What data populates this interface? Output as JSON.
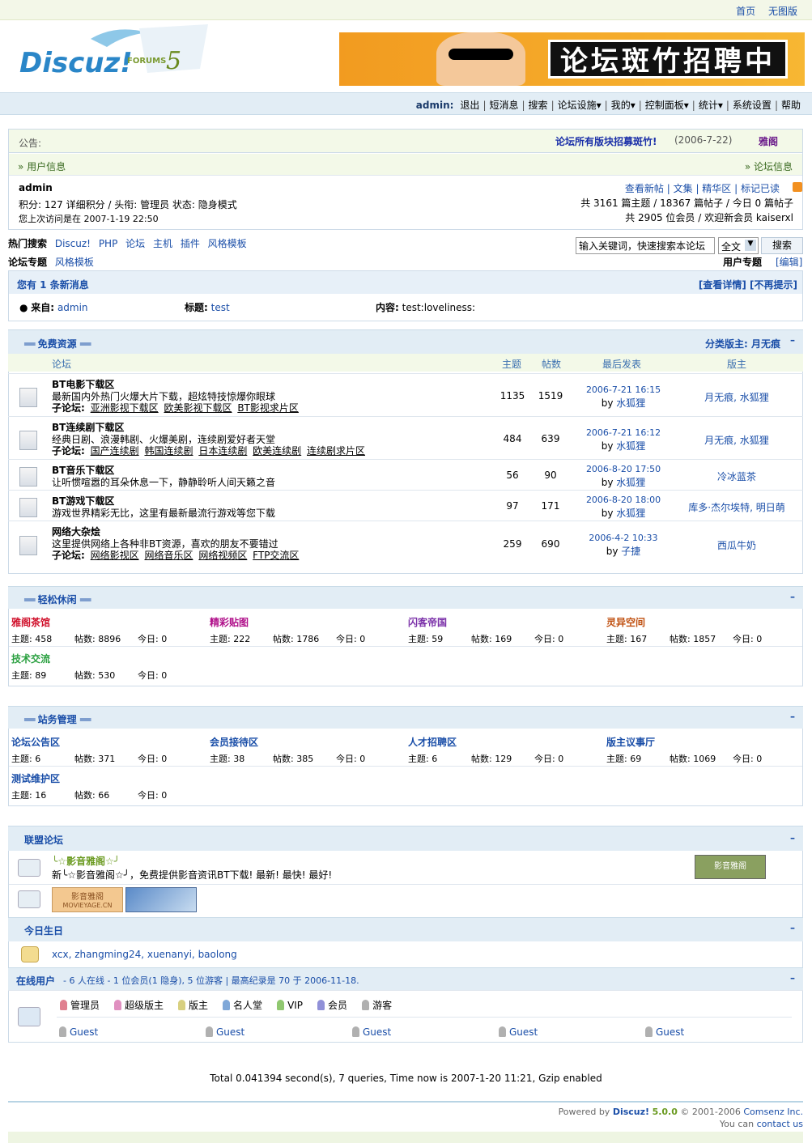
{
  "top_links": [
    "首页",
    "无图版"
  ],
  "logo_text": "Discuz!",
  "logo_sub": "FORUMS",
  "logo_ver": "5",
  "banner_text": "论坛斑竹招聘中",
  "nav": {
    "user": "admin:",
    "items": [
      "退出",
      "短消息",
      "搜索",
      "论坛设施▾",
      "我的▾",
      "控制面板▾",
      "统计▾",
      "系统设置",
      "帮助"
    ]
  },
  "notice": {
    "label": "公告:",
    "title": "论坛所有版块招募斑竹!",
    "date": "(2006-7-22)",
    "author": "雅阁"
  },
  "userinfo": {
    "left_title": "» 用户信息",
    "right_title": "» 论坛信息",
    "username": "admin",
    "line1": "积分: 127 详细积分 / 头衔: 管理员 状态: 隐身模式",
    "line2": "您上次访问是在 2007-1-19 22:50",
    "links": [
      "查看新帖",
      "文集",
      "精华区",
      "标记已读"
    ],
    "stats1": "共 3161 篇主题 / 18367 篇帖子 / 今日 0 篇帖子",
    "stats2": "共 2905 位会员 / 欢迎新会员 kaiserxl"
  },
  "hot": {
    "label": "热门搜索",
    "items": [
      "Discuz!",
      "PHP",
      "论坛",
      "主机",
      "插件",
      "风格模板"
    ],
    "label2": "论坛专题",
    "items2": [
      "风格模板"
    ],
    "search_placeholder": "输入关键词，快速搜索本论坛",
    "select": "全文",
    "search_btn": "搜索",
    "user_topic": "用户专题",
    "edit": "[编辑]"
  },
  "pm": {
    "title": "您有 1 条新消息",
    "right": "[查看详情] [不再提示]",
    "from_label": "来自:",
    "from": "admin",
    "subject_label": "标题:",
    "subject": "test",
    "content_label": "内容:",
    "content": "test:loveliness:"
  },
  "free": {
    "title": "免费资源",
    "mod": "分类版主: 月无痕",
    "cols": [
      "论坛",
      "主题",
      "帖数",
      "最后发表",
      "版主"
    ],
    "forums": [
      {
        "name": "BT电影下载区",
        "desc": "最新国内外热门火爆大片下载，超炫特技惊爆你眼球",
        "subs": [
          "亚洲影视下载区",
          "欧美影视下载区",
          "BT影视求片区"
        ],
        "topics": "1135",
        "posts": "1519",
        "last": "2006-7-21 16:15",
        "by": "by 水狐狸",
        "mods": "月无痕, 水狐狸"
      },
      {
        "name": "BT连续剧下载区",
        "desc": "经典日剧、浪漫韩剧、火爆美剧，连续剧爱好者天堂",
        "subs": [
          "国产连续剧",
          "韩国连续剧",
          "日本连续剧",
          "欧美连续剧",
          "连续剧求片区"
        ],
        "topics": "484",
        "posts": "639",
        "last": "2006-7-21 16:12",
        "by": "by 水狐狸",
        "mods": "月无痕, 水狐狸"
      },
      {
        "name": "BT音乐下载区",
        "desc": "让听惯喧嚣的耳朵休息一下，静静聆听人间天籁之音",
        "subs": [],
        "topics": "56",
        "posts": "90",
        "last": "2006-8-20 17:50",
        "by": "by 水狐狸",
        "mods": "冷冰蓝茶"
      },
      {
        "name": "BT游戏下载区",
        "desc": "游戏世界精彩无比，这里有最新最流行游戏等您下载",
        "subs": [],
        "topics": "97",
        "posts": "171",
        "last": "2006-8-20 18:00",
        "by": "by 水狐狸",
        "mods": "库多·杰尔埃特, 明日萌"
      },
      {
        "name": "网络大杂烩",
        "desc": "这里提供网络上各种非BT资源，喜欢的朋友不要错过",
        "subs": [
          "网络影视区",
          "网络音乐区",
          "网络视频区",
          "FTP交流区"
        ],
        "topics": "259",
        "posts": "690",
        "last": "2006-4-2 10:33",
        "by": "by 子捷",
        "mods": "西瓜牛奶"
      }
    ],
    "sub_label": "子论坛:"
  },
  "relax": {
    "title": "轻松休闲",
    "forums": [
      {
        "name": "雅阁茶馆",
        "color": "#d0102b",
        "t": "主题: 458",
        "p": "帖数: 8896",
        "d": "今日: 0"
      },
      {
        "name": "精彩贴图",
        "color": "#b0108a",
        "t": "主题: 222",
        "p": "帖数: 1786",
        "d": "今日: 0"
      },
      {
        "name": "闪客帝国",
        "color": "#7a2fa8",
        "t": "主题: 59",
        "p": "帖数: 169",
        "d": "今日: 0"
      },
      {
        "name": "灵异空间",
        "color": "#c05010",
        "t": "主题: 167",
        "p": "帖数: 1857",
        "d": "今日: 0"
      },
      {
        "name": "技术交流",
        "color": "#2aa040",
        "t": "主题: 89",
        "p": "帖数: 530",
        "d": "今日: 0"
      }
    ]
  },
  "admin": {
    "title": "站务管理",
    "forums": [
      {
        "name": "论坛公告区",
        "t": "主题: 6",
        "p": "帖数: 371",
        "d": "今日: 0"
      },
      {
        "name": "会员接待区",
        "t": "主题: 38",
        "p": "帖数: 385",
        "d": "今日: 0"
      },
      {
        "name": "人才招聘区",
        "t": "主题: 6",
        "p": "帖数: 129",
        "d": "今日: 0"
      },
      {
        "name": "版主议事厅",
        "t": "主题: 69",
        "p": "帖数: 1069",
        "d": "今日: 0"
      },
      {
        "name": "测试维护区",
        "t": "主题: 16",
        "p": "帖数: 66",
        "d": "今日: 0"
      }
    ]
  },
  "league": {
    "title": "联盟论坛",
    "name": "╰☆影音雅阁☆╯",
    "desc": "新╰☆影音雅阁☆╯，免费提供影音资讯BT下载! 最新! 最快! 最好!",
    "logo1": "影音雅阁",
    "logo1b": "MOVIEYAGE.CN",
    "logo2": "影音雅阁"
  },
  "birthday": {
    "title": "今日生日",
    "names": "xcx, zhangming24, xuenanyi, baolong"
  },
  "online": {
    "title": "在线用户",
    "summary": "- 6 人在线 - 1 位会员(1 隐身), 5 位游客 | 最高纪录是 70 于 2006-11-18.",
    "legend": [
      "管理员",
      "超级版主",
      "版主",
      "名人堂",
      "VIP",
      "会员",
      "游客"
    ],
    "guests": [
      "Guest",
      "Guest",
      "Guest",
      "Guest",
      "Guest"
    ]
  },
  "footer": {
    "stats": "Total 0.041394 second(s), 7 queries, Time now is 2007-1-20 11:21, Gzip enabled",
    "powered": "Powered by",
    "brand": "Discuz!",
    "ver": "5.0.0",
    "copy": "© 2001-2006",
    "company": "Comsenz Inc.",
    "contact_pre": "You can",
    "contact": "contact us"
  },
  "colors": {
    "link": "#1a4ea8",
    "header_bg": "#e2edf5",
    "green_bg": "#f3f9e8"
  }
}
